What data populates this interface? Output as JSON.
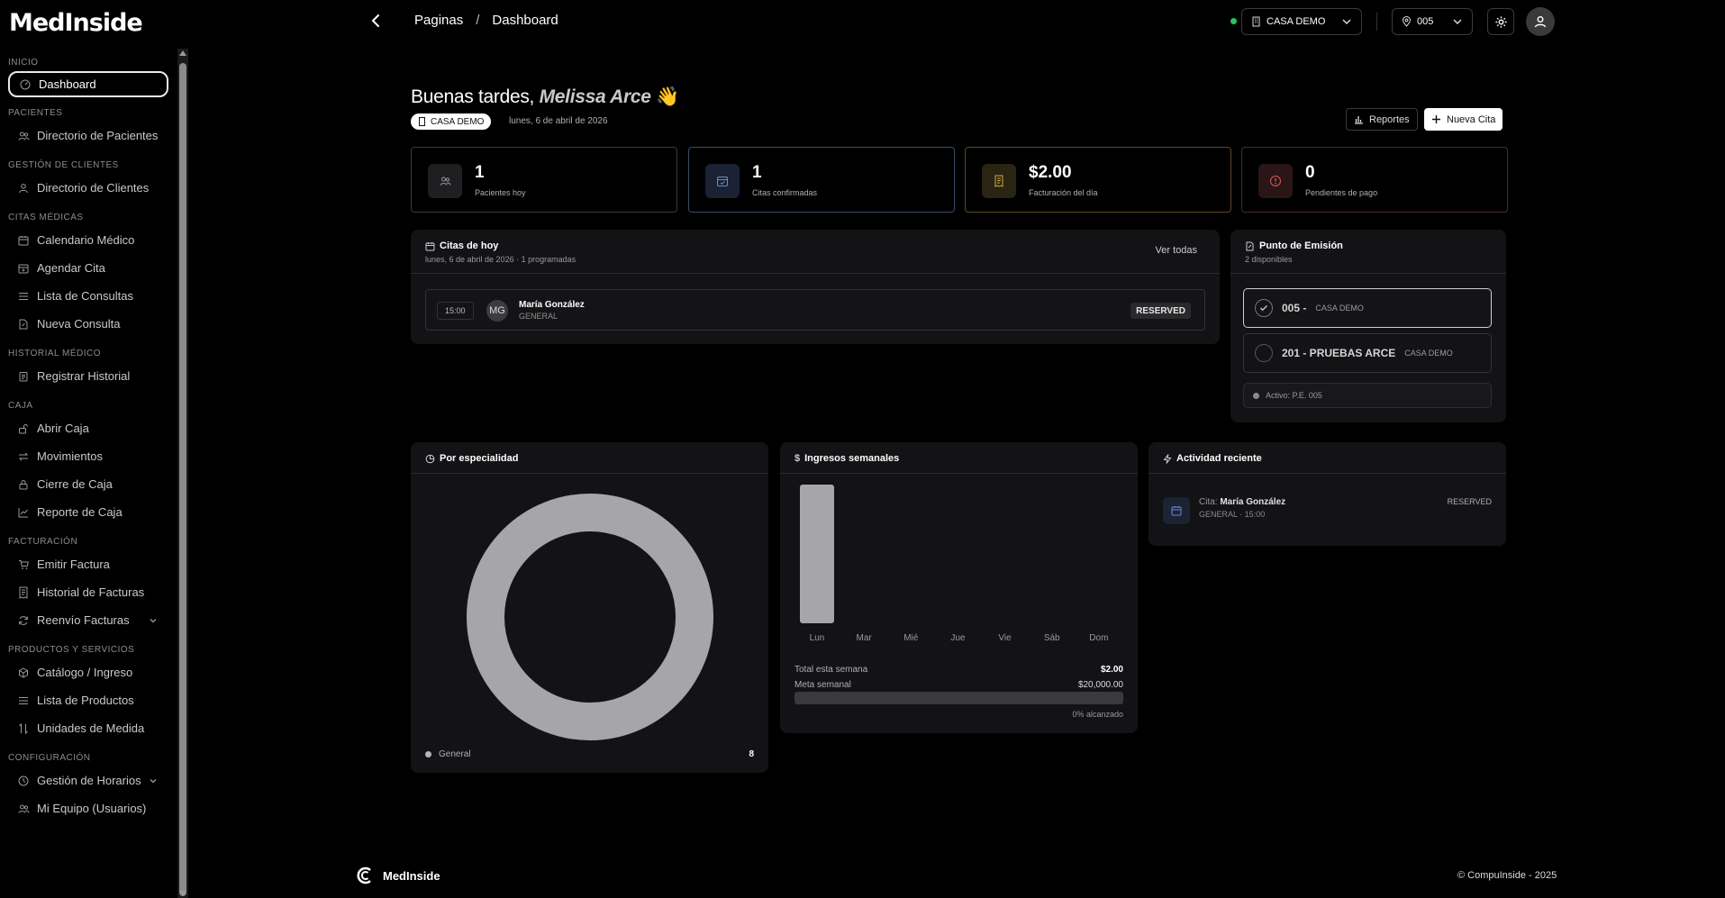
{
  "brand": {
    "name": "MedInside"
  },
  "sidebar": {
    "sections": [
      {
        "title": "INICIO",
        "items": [
          {
            "label": "Dashboard",
            "icon": "dashboard-icon",
            "active": true
          }
        ]
      },
      {
        "title": "PACIENTES",
        "items": [
          {
            "label": "Directorio de Pacientes",
            "icon": "users-icon"
          }
        ]
      },
      {
        "title": "GESTIÓN DE CLIENTES",
        "items": [
          {
            "label": "Directorio de Clientes",
            "icon": "user-icon"
          }
        ]
      },
      {
        "title": "CITAS MÉDICAS",
        "items": [
          {
            "label": "Calendario Médico",
            "icon": "calendar-icon"
          },
          {
            "label": "Agendar Cita",
            "icon": "calendar-plus-icon"
          },
          {
            "label": "Lista de Consultas",
            "icon": "list-icon"
          },
          {
            "label": "Nueva Consulta",
            "icon": "file-edit-icon"
          }
        ]
      },
      {
        "title": "HISTORIAL MÉDICO",
        "items": [
          {
            "label": "Registrar Historial",
            "icon": "clipboard-icon"
          }
        ]
      },
      {
        "title": "CAJA",
        "items": [
          {
            "label": "Abrir Caja",
            "icon": "unlock-icon"
          },
          {
            "label": "Movimientos",
            "icon": "arrows-icon"
          },
          {
            "label": "Cierre de Caja",
            "icon": "lock-icon"
          },
          {
            "label": "Reporte de Caja",
            "icon": "trend-icon"
          }
        ]
      },
      {
        "title": "FACTURACIÓN",
        "items": [
          {
            "label": "Emitir Factura",
            "icon": "cart-icon"
          },
          {
            "label": "Historial de Facturas",
            "icon": "receipt-icon"
          },
          {
            "label": "Reenvío Facturas",
            "icon": "refresh-icon",
            "expandable": true
          }
        ]
      },
      {
        "title": "PRODUCTOS Y SERVICIOS",
        "items": [
          {
            "label": "Catálogo / Ingreso",
            "icon": "box-icon"
          },
          {
            "label": "Lista de Productos",
            "icon": "list-icon"
          },
          {
            "label": "Unidades de Medida",
            "icon": "sort-icon"
          }
        ]
      },
      {
        "title": "CONFIGURACIÓN",
        "items": [
          {
            "label": "Gestión de Horarios",
            "icon": "clock-icon",
            "expandable": true
          },
          {
            "label": "Mi Equipo (Usuarios)",
            "icon": "team-icon"
          }
        ]
      }
    ]
  },
  "topbar": {
    "breadcrumb": {
      "root": "Paginas",
      "separator": "/",
      "current": "Dashboard"
    },
    "branch_select": "CASA DEMO",
    "location_select": "005"
  },
  "greeting": {
    "prefix": "Buenas tardes,",
    "name": "Melissa Arce",
    "emoji": "👋",
    "chip": "CASA DEMO",
    "date": "lunes, 6 de abril de 2026"
  },
  "actions": {
    "reports": "Reportes",
    "new_appointment": "Nueva Cita"
  },
  "stats": [
    {
      "value": "1",
      "label": "Pacientes hoy",
      "icon": "users-icon",
      "border": "#3a3a3a",
      "icon_bg": "#1f1f22",
      "icon_color": "#9a9a9a"
    },
    {
      "value": "1",
      "label": "Citas confirmadas",
      "icon": "calendar-check-icon",
      "border": "#3a4a66",
      "icon_bg": "#1a2233",
      "icon_color": "#6a8ad6"
    },
    {
      "value": "$2.00",
      "label": "Facturación del día",
      "icon": "receipt-icon",
      "border": "#5a4a22",
      "icon_bg": "#2a2412",
      "icon_color": "#d4a93a"
    },
    {
      "value": "0",
      "label": "Pendientes de pago",
      "icon": "alert-icon",
      "border": "#4a2a2a",
      "icon_bg": "#2a1616",
      "icon_color": "#d65a5a"
    }
  ],
  "today": {
    "title": "Citas de hoy",
    "subtitle": "lunes, 6 de abril de 2026 · 1 programadas",
    "view_all": "Ver todas",
    "appointments": [
      {
        "time": "15:00",
        "initials": "MG",
        "name": "María González",
        "specialty": "GENERAL",
        "status": "RESERVED"
      }
    ]
  },
  "emission": {
    "title": "Punto de Emisión",
    "subtitle": "2 disponibles",
    "options": [
      {
        "code": "005 -",
        "location": "CASA DEMO",
        "selected": true
      },
      {
        "code": "201 - PRUEBAS ARCE",
        "location": "CASA DEMO",
        "selected": false
      }
    ],
    "active": "Activo: P.E. 005"
  },
  "specialty": {
    "title": "Por especialidad",
    "legend": [
      {
        "label": "General",
        "count": "8"
      }
    ]
  },
  "weekly": {
    "title": "Ingresos semanales",
    "total_label": "Total esta semana",
    "total_value": "$2.00",
    "goal_label": "Meta semanal",
    "goal_value": "$20,000.00",
    "progress_text": "0% alcanzado",
    "progress_fraction": 0.0001
  },
  "chart_data": [
    {
      "type": "pie",
      "title": "Por especialidad",
      "categories": [
        "General"
      ],
      "values": [
        8
      ],
      "colors": [
        "#a5a5aa"
      ]
    },
    {
      "type": "bar",
      "title": "Ingresos semanales",
      "categories": [
        "Lun",
        "Mar",
        "Mié",
        "Jue",
        "Vie",
        "Sáb",
        "Dom"
      ],
      "values": [
        2,
        0,
        0,
        0,
        0,
        0,
        0
      ],
      "colors": [
        "#a5a5aa"
      ]
    }
  ],
  "activity": {
    "title": "Actividad reciente",
    "items": [
      {
        "prefix": "Cita:",
        "name": "María González",
        "meta": "GENERAL · 15:00",
        "status": "RESERVED"
      }
    ]
  },
  "footer": {
    "brand": "MedInside",
    "copyright": "© CompuInside - 2025"
  }
}
